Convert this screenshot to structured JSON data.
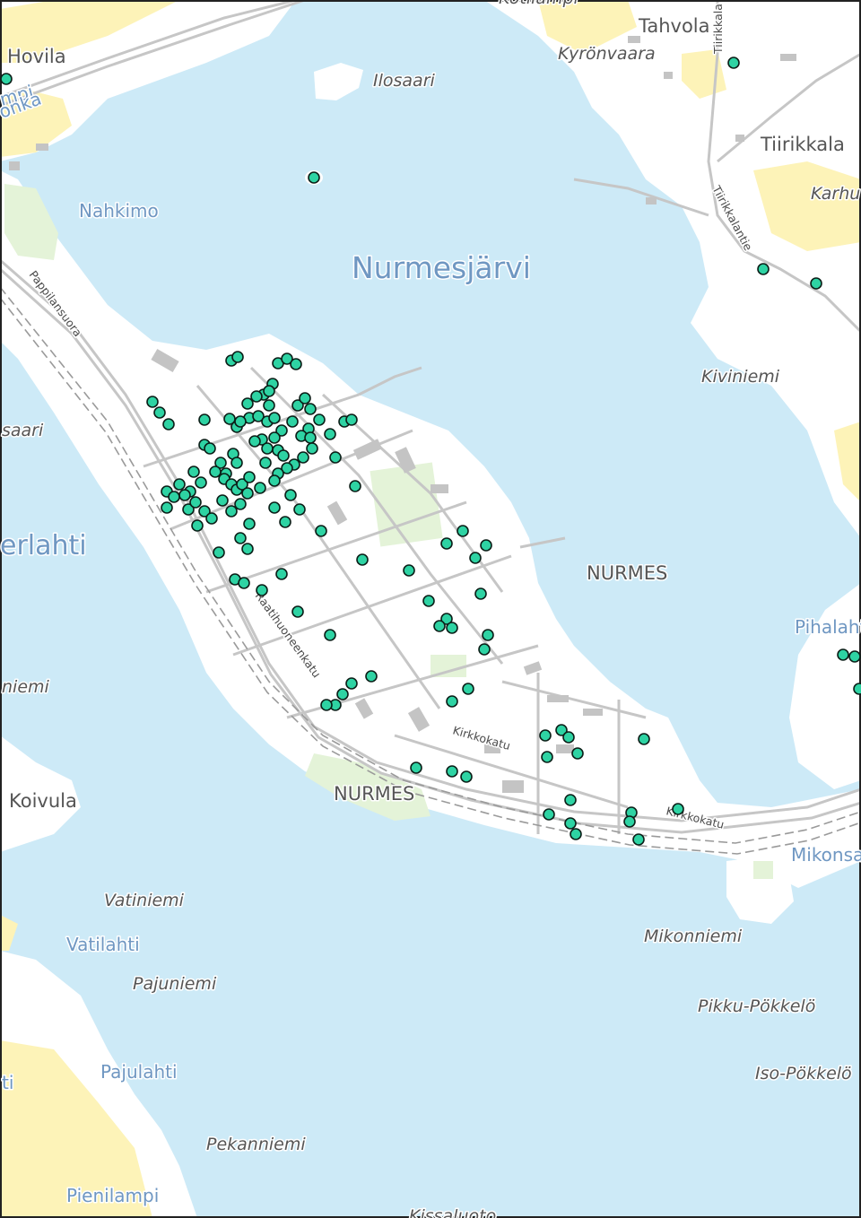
{
  "map": {
    "colors": {
      "water": "#cdeaf7",
      "land": "#ffffff",
      "field": "#fdf3b8",
      "green": "#e4f3d8",
      "road": "#bfbfbf",
      "building": "#c4c4c4",
      "marker": "#2ed3a3",
      "marker_outline": "#0b1f18",
      "border": "#222222"
    },
    "labels": {
      "town": "NURMES",
      "lake": "Nurmesjärvi",
      "station": "NURMES",
      "hovila": "Hovila",
      "tahvola": "Tahvola",
      "kyronvaara": "Kyrönvaara",
      "tiirikkala": "Tiirikkala",
      "karhu": "Karhu",
      "ilosaari": "Ilosaari",
      "nahkimo": "Nahkimo",
      "kiviniemi": "Kiviniemi",
      "saari": "saari",
      "erlahti": "erlahti",
      "niemi": "niemi",
      "koivula": "Koivula",
      "vatiniemi": "Vatiniemi",
      "vatilahti": "Vatilahti",
      "pajuniemi": "Pajuniemi",
      "pajulahti": "Pajulahti",
      "ti": "ti",
      "pekanniemi": "Pekanniemi",
      "pienilampi": "Pienilampi",
      "mikonniemi": "Mikonniemi",
      "pikku_pokkelo": "Pikku-Pökkelö",
      "iso_pokkelo": "Iso-Pökkelö",
      "mikonsa": "Mikonsa",
      "pihalahti": "Pihalahti",
      "kissaluoto": "Kissaluoto",
      "kotilampi": "Kotilampi",
      "lampi_left": "mpi",
      "honka_left": "onka",
      "street_pappilansuora": "Pappilansuora",
      "street_raatihuoneenkatu": "Raatihuoneenkatu",
      "street_kirkkokatu_1": "Kirkkokatu",
      "street_kirkkokatu_2": "Kirkkokatu",
      "street_tiirikkalantie": "Tiirikkalantie",
      "street_tiirikkala_v": "Tiirikkala"
    },
    "markers_count": 150
  }
}
